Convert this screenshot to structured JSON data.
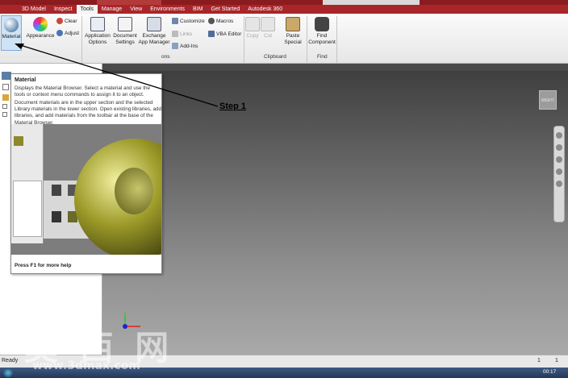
{
  "menubar": {
    "tabs": [
      "3D Model",
      "Inspect",
      "Tools",
      "Manage",
      "View",
      "Environments",
      "BIM",
      "Get Started",
      "Autodesk 360"
    ],
    "active_tab": "Tools"
  },
  "ribbon": {
    "material": "Material",
    "appearance": "Appearance",
    "clear": "Clear",
    "adjust": "Adjust",
    "app_options": "Application Options",
    "doc_settings": "Document Settings",
    "exchange": "Exchange App Manager",
    "customize": "Customize",
    "links": "Links",
    "addins": "Add-Ins",
    "macros": "Macros",
    "vba": "VBA Editor",
    "copy": "Copy",
    "cut": "Cut",
    "paste_special": "Paste Special",
    "find_component": "Find Component",
    "options_panel": "ons",
    "clipboard_panel": "Clipboard",
    "find_panel": "Find"
  },
  "tooltip": {
    "title": "Material",
    "desc": "Displays the Material Browser. Select a material and use the tools or context menu commands to assign it to an object.",
    "detail": "Document materials are in the upper section and the selected Library materials in the lower section. Open existing libraries, add libraries, and add materials from the toolbar at the base of the Material Browser.",
    "footer": "Press F1 for more help"
  },
  "annotation": {
    "step": "Step 1"
  },
  "status": {
    "text": "Ready",
    "num1": "1",
    "num2": "1"
  },
  "taskbar": {
    "time": "00:17"
  },
  "watermark": {
    "chars": "莫 西 网",
    "url": "www.3dmax.com"
  },
  "viewcube": {
    "label": "RIGHT"
  },
  "colors": {
    "accent": "#a8262a"
  }
}
